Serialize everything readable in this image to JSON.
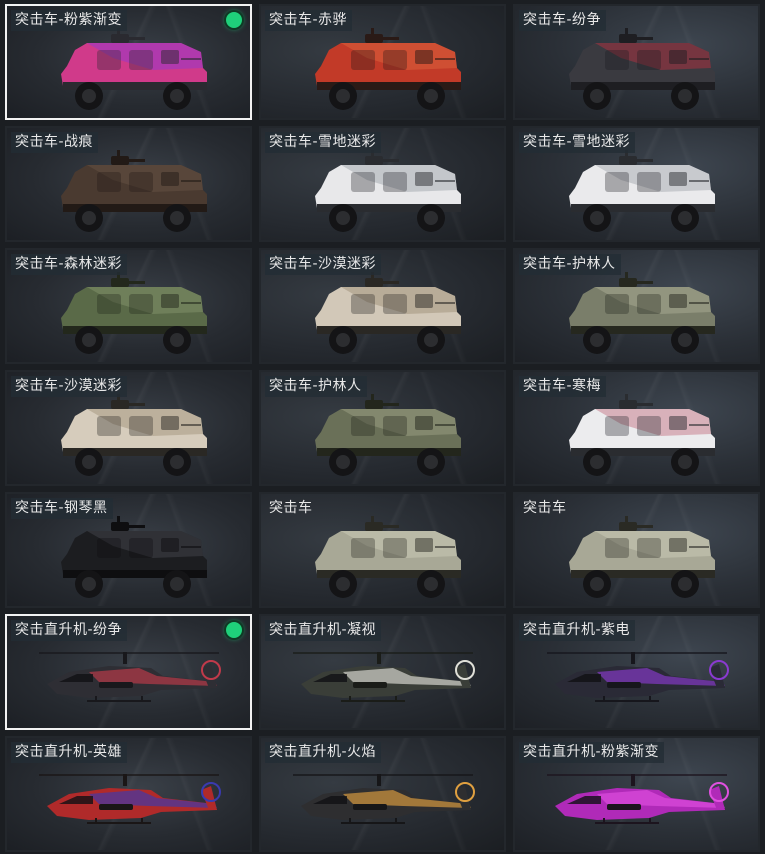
{
  "grid": {
    "items": [
      {
        "label": "突击车-粉紫渐变",
        "kind": "truck",
        "equipped": true,
        "colors": {
          "body": "#d03a8a",
          "accent": "#8a3ad6",
          "dark": "#2a2a30"
        }
      },
      {
        "label": "突击车-赤骅",
        "kind": "truck",
        "equipped": false,
        "colors": {
          "body": "#c23a28",
          "accent": "#e06a40",
          "dark": "#2a1a16"
        }
      },
      {
        "label": "突击车-纷争",
        "kind": "truck",
        "equipped": false,
        "colors": {
          "body": "#3a3a40",
          "accent": "#c03040",
          "dark": "#1e1e22"
        }
      },
      {
        "label": "突击车-战痕",
        "kind": "truck",
        "equipped": false,
        "colors": {
          "body": "#4a3a30",
          "accent": "#6a5646",
          "dark": "#221a16"
        }
      },
      {
        "label": "突击车-雪地迷彩",
        "kind": "truck",
        "equipped": false,
        "colors": {
          "body": "#e8e8ea",
          "accent": "#9aa0a6",
          "dark": "#2a2c30"
        }
      },
      {
        "label": "突击车-雪地迷彩",
        "kind": "truck",
        "equipped": false,
        "colors": {
          "body": "#eaeaec",
          "accent": "#a0a4aa",
          "dark": "#2a2c30"
        }
      },
      {
        "label": "突击车-森林迷彩",
        "kind": "truck",
        "equipped": false,
        "colors": {
          "body": "#5a6a48",
          "accent": "#8a9a70",
          "dark": "#23281c"
        }
      },
      {
        "label": "突击车-沙漠迷彩",
        "kind": "truck",
        "equipped": false,
        "colors": {
          "body": "#d2c8b8",
          "accent": "#9a8a72",
          "dark": "#2a2824"
        }
      },
      {
        "label": "突击车-护林人",
        "kind": "truck",
        "equipped": false,
        "colors": {
          "body": "#7a7e6a",
          "accent": "#b0b29a",
          "dark": "#26281f"
        }
      },
      {
        "label": "突击车-沙漠迷彩",
        "kind": "truck",
        "equipped": false,
        "colors": {
          "body": "#d6ccbc",
          "accent": "#9e8e76",
          "dark": "#2a2824"
        }
      },
      {
        "label": "突击车-护林人",
        "kind": "truck",
        "equipped": false,
        "colors": {
          "body": "#6a7058",
          "accent": "#a2a68a",
          "dark": "#23261c"
        }
      },
      {
        "label": "突击车-寒梅",
        "kind": "truck",
        "equipped": false,
        "colors": {
          "body": "#ececee",
          "accent": "#c26a7a",
          "dark": "#2a2c30"
        }
      },
      {
        "label": "突击车-钢琴黑",
        "kind": "truck",
        "equipped": false,
        "colors": {
          "body": "#1c1d20",
          "accent": "#4a4c52",
          "dark": "#0e0e10"
        }
      },
      {
        "label": "突击车",
        "kind": "truck",
        "equipped": false,
        "plain": true,
        "colors": {
          "body": "#a8a896",
          "accent": "#d0d0bc",
          "dark": "#2a2a24"
        }
      },
      {
        "label": "突击车",
        "kind": "truck",
        "equipped": false,
        "plain": true,
        "colors": {
          "body": "#a8a896",
          "accent": "#d0d0bc",
          "dark": "#2a2a24"
        }
      },
      {
        "label": "突击直升机-纷争",
        "kind": "heli",
        "equipped": true,
        "colors": {
          "body": "#2e2e34",
          "accent": "#c03a4a",
          "dark": "#18181c"
        }
      },
      {
        "label": "突击直升机-凝视",
        "kind": "heli",
        "equipped": false,
        "colors": {
          "body": "#3a3e38",
          "accent": "#e0e0d8",
          "dark": "#1a1c18"
        }
      },
      {
        "label": "突击直升机-紫电",
        "kind": "heli",
        "equipped": false,
        "colors": {
          "body": "#2a2a36",
          "accent": "#8a3ad0",
          "dark": "#16161c"
        }
      },
      {
        "label": "突击直升机-英雄",
        "kind": "heli",
        "equipped": false,
        "colors": {
          "body": "#b02a2a",
          "accent": "#3a3ab0",
          "dark": "#1a1616"
        }
      },
      {
        "label": "突击直升机-火焰",
        "kind": "heli",
        "equipped": false,
        "colors": {
          "body": "#2e2e30",
          "accent": "#e0a040",
          "dark": "#161618"
        }
      },
      {
        "label": "突击直升机-粉紫渐变",
        "kind": "heli",
        "equipped": false,
        "colors": {
          "body": "#b02ab8",
          "accent": "#e050e0",
          "dark": "#1c141e"
        }
      }
    ]
  }
}
